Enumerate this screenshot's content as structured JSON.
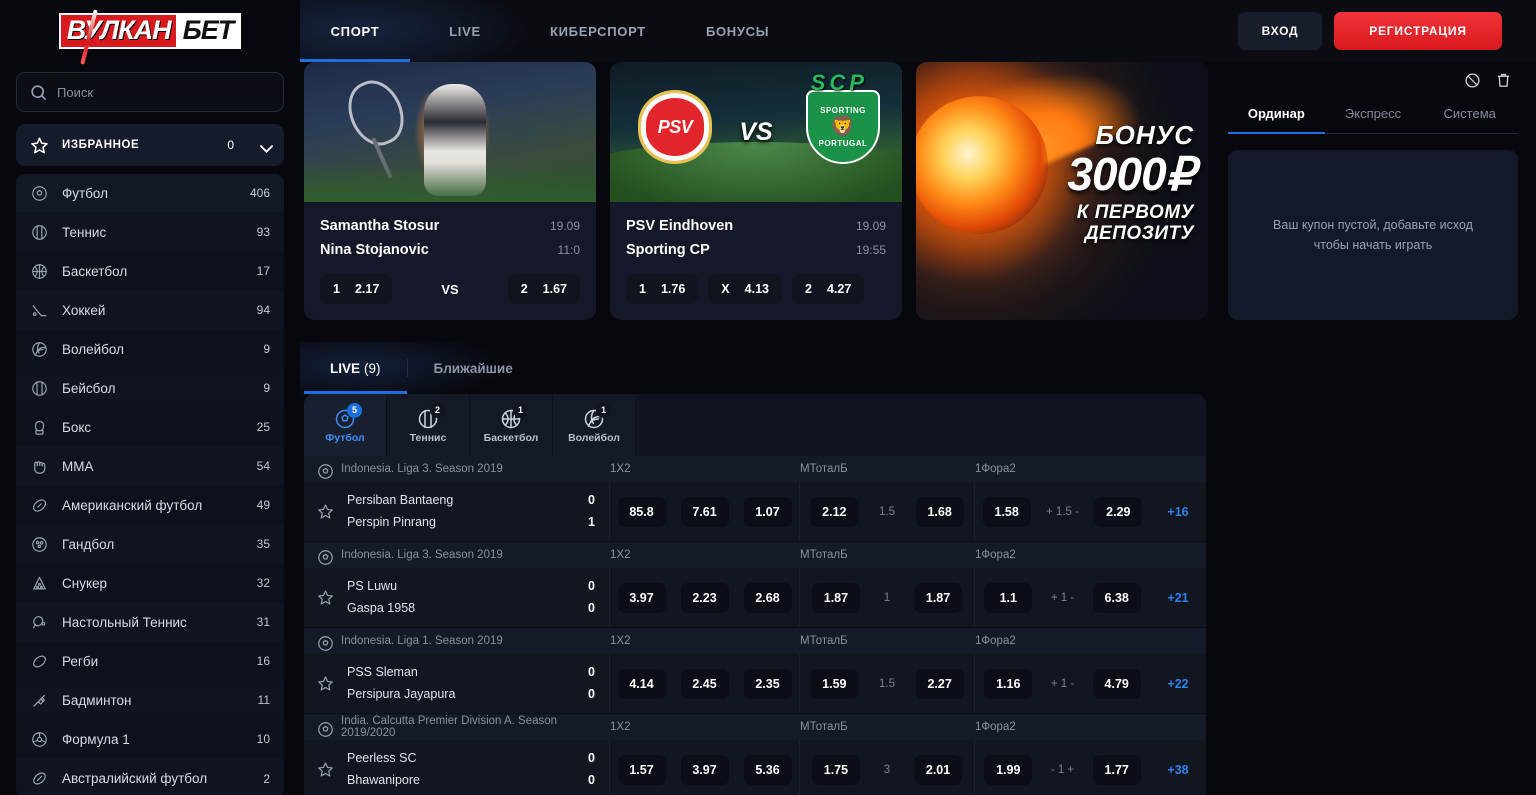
{
  "brand": {
    "part1": "ВУЛКАН",
    "part2": "БЕТ"
  },
  "search": {
    "placeholder": "Поиск",
    "value": ""
  },
  "favorites": {
    "label": "ИЗБРАННОЕ",
    "count": "0"
  },
  "sidebar": {
    "items": [
      {
        "icon": "soccer-ball-icon",
        "label": "Футбол",
        "count": "406"
      },
      {
        "icon": "tennis-ball-icon",
        "label": "Теннис",
        "count": "93"
      },
      {
        "icon": "basketball-icon",
        "label": "Баскетбол",
        "count": "17"
      },
      {
        "icon": "hockey-stick-icon",
        "label": "Хоккей",
        "count": "94"
      },
      {
        "icon": "volleyball-icon",
        "label": "Волейбол",
        "count": "9"
      },
      {
        "icon": "baseball-icon",
        "label": "Бейсбол",
        "count": "9"
      },
      {
        "icon": "boxing-glove-icon",
        "label": "Бокс",
        "count": "25"
      },
      {
        "icon": "fist-icon",
        "label": "MMA",
        "count": "54"
      },
      {
        "icon": "american-football-icon",
        "label": "Американский футбол",
        "count": "49"
      },
      {
        "icon": "handball-icon",
        "label": "Гандбол",
        "count": "35"
      },
      {
        "icon": "snooker-icon",
        "label": "Снукер",
        "count": "32"
      },
      {
        "icon": "table-tennis-icon",
        "label": "Настольный Теннис",
        "count": "31"
      },
      {
        "icon": "rugby-ball-icon",
        "label": "Регби",
        "count": "16"
      },
      {
        "icon": "shuttlecock-icon",
        "label": "Бадминтон",
        "count": "11"
      },
      {
        "icon": "steering-wheel-icon",
        "label": "Формула 1",
        "count": "10"
      },
      {
        "icon": "aussie-football-icon",
        "label": "Австралийский футбол",
        "count": "2"
      }
    ]
  },
  "topnav": {
    "tabs": [
      {
        "label": "СПОРТ",
        "active": true
      },
      {
        "label": "LIVE",
        "active": false
      },
      {
        "label": "КИБЕРСПОРТ",
        "active": false
      },
      {
        "label": "БОНУСЫ",
        "active": false
      }
    ],
    "login_label": "ВХОД",
    "register_label": "РЕГИСТРАЦИЯ"
  },
  "banners": [
    {
      "kind": "tennis-match",
      "team1": "Samantha Stosur",
      "team2": "Nina Stojanovic",
      "date": "19.09",
      "time": "11:0",
      "vs_label": "VS",
      "odds": [
        {
          "key": "1",
          "value": "2.17"
        },
        {
          "key": "2",
          "value": "1.67"
        }
      ]
    },
    {
      "kind": "football-match",
      "team1": "PSV Eindhoven",
      "team2": "Sporting CP",
      "date": "19.09",
      "time": "19:55",
      "crest1": "PSV",
      "crest2_top": "SCP",
      "crest2_a": "SPORTING",
      "crest2_b": "PORTUGAL",
      "vs_label": "VS",
      "odds": [
        {
          "key": "1",
          "value": "1.76"
        },
        {
          "key": "X",
          "value": "4.13"
        },
        {
          "key": "2",
          "value": "4.27"
        }
      ]
    },
    {
      "kind": "bonus-promo",
      "line1": "БОНУС",
      "line2": "3000₽",
      "line3a": "К ПЕРВОМУ",
      "line3b": "ДЕПОЗИТУ"
    }
  ],
  "live": {
    "tabs": [
      {
        "label": "LIVE",
        "count": "(9)",
        "active": true
      },
      {
        "label": "Ближайшие",
        "count": "",
        "active": false
      }
    ],
    "sport_tabs": [
      {
        "label": "Футбол",
        "badge": "5",
        "icon": "soccer-ball-icon",
        "active": true
      },
      {
        "label": "Теннис",
        "badge": "2",
        "icon": "tennis-ball-icon",
        "active": false
      },
      {
        "label": "Баскетбол",
        "badge": "1",
        "icon": "basketball-icon",
        "active": false
      },
      {
        "label": "Волейбол",
        "badge": "1",
        "icon": "volleyball-icon",
        "active": false
      }
    ],
    "market_headers": {
      "g1": [
        "1",
        "X",
        "2"
      ],
      "g2": [
        "М",
        "Тотал",
        "Б"
      ],
      "g3": [
        "1",
        "Фора",
        "2"
      ]
    },
    "events": [
      {
        "league": "Indonesia. Liga 3. Season 2019",
        "team1": "Persiban Bantaeng",
        "team2": "Perspin Pinrang",
        "score1": "0",
        "score2": "1",
        "o1": "85.8",
        "ox": "7.61",
        "o2": "1.07",
        "tm": "2.12",
        "tline": "1.5",
        "tb": "1.68",
        "h1": "1.58",
        "hline": "+ 1.5 -",
        "h2": "2.29",
        "more": "+16"
      },
      {
        "league": "Indonesia. Liga 3. Season 2019",
        "team1": "PS Luwu",
        "team2": "Gaspa 1958",
        "score1": "0",
        "score2": "0",
        "o1": "3.97",
        "ox": "2.23",
        "o2": "2.68",
        "tm": "1.87",
        "tline": "1",
        "tb": "1.87",
        "h1": "1.1",
        "hline": "+ 1 -",
        "h2": "6.38",
        "more": "+21"
      },
      {
        "league": "Indonesia. Liga 1. Season 2019",
        "team1": "PSS Sleman",
        "team2": "Persipura Jayapura",
        "score1": "0",
        "score2": "0",
        "o1": "4.14",
        "ox": "2.45",
        "o2": "2.35",
        "tm": "1.59",
        "tline": "1.5",
        "tb": "2.27",
        "h1": "1.16",
        "hline": "+ 1 -",
        "h2": "4.79",
        "more": "+22"
      },
      {
        "league": "India. Calcutta Premier Division A. Season 2019/2020",
        "team1": "Peerless SC",
        "team2": "Bhawanipore",
        "score1": "0",
        "score2": "0",
        "o1": "1.57",
        "ox": "3.97",
        "o2": "5.36",
        "tm": "1.75",
        "tline": "3",
        "tb": "2.01",
        "h1": "1.99",
        "hline": "- 1 +",
        "h2": "1.77",
        "more": "+38"
      }
    ]
  },
  "betslip": {
    "icons": [
      "no-bets-icon",
      "trash-icon"
    ],
    "tabs": [
      {
        "label": "Ординар",
        "active": true
      },
      {
        "label": "Экспресс",
        "active": false
      },
      {
        "label": "Система",
        "active": false
      }
    ],
    "empty_message": "Ваш купон пустой, добавьте исход чтобы начать играть"
  },
  "colors": {
    "accent_blue": "#1b6fe0",
    "brand_red": "#d9181d",
    "link_blue": "#2f82ef",
    "bg": "#07080d",
    "panel": "#10141f"
  }
}
